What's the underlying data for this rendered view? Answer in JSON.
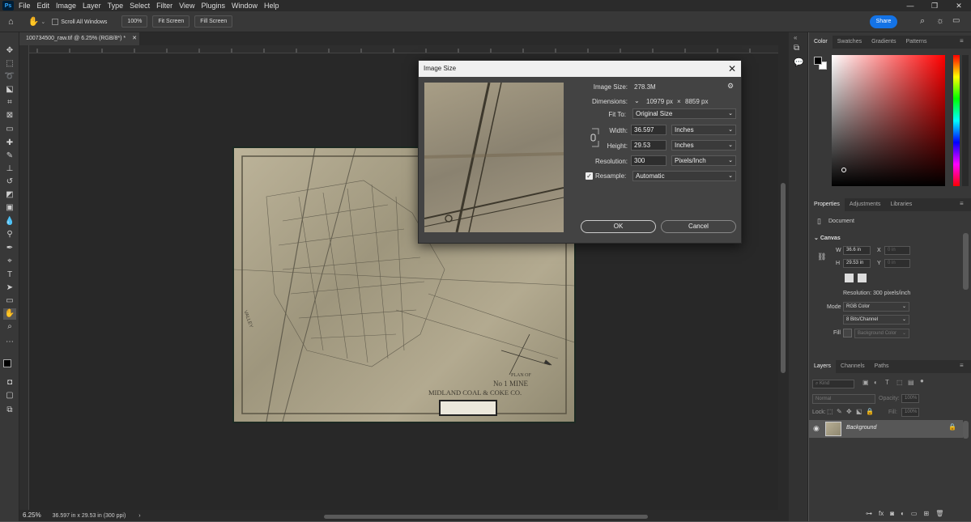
{
  "menubar": {
    "app_icon": "Ps",
    "items": [
      "File",
      "Edit",
      "Image",
      "Layer",
      "Type",
      "Select",
      "Filter",
      "View",
      "Plugins",
      "Window",
      "Help"
    ]
  },
  "options_bar": {
    "scroll_all_label": "Scroll All Windows",
    "zoom_100": "100%",
    "fit_screen": "Fit Screen",
    "fill_screen": "Fill Screen",
    "share": "Share"
  },
  "document": {
    "tab_title": "100734500_raw.tif @ 6.25% (RGB/8*) *"
  },
  "status_bar": {
    "zoom": "6.25%",
    "info": "36.597 in x 29.53 in (300 ppi)"
  },
  "map_text": {
    "title_line1": "PLAN OF",
    "title_line2": "No 1 MINE",
    "title_line3": "MIDLAND COAL & COKE CO.",
    "valley": "VALLEY"
  },
  "image_size_dialog": {
    "title": "Image Size",
    "image_size_label": "Image Size:",
    "image_size_value": "278.3M",
    "dimensions_label": "Dimensions:",
    "dim_w": "10979 px",
    "dim_x": "×",
    "dim_h": "8859 px",
    "fit_to_label": "Fit To:",
    "fit_to_value": "Original Size",
    "width_label": "Width:",
    "width_value": "36.597",
    "width_unit": "Inches",
    "height_label": "Height:",
    "height_value": "29.53",
    "height_unit": "Inches",
    "resolution_label": "Resolution:",
    "resolution_value": "300",
    "resolution_unit": "Pixels/Inch",
    "resample_label": "Resample:",
    "resample_value": "Automatic",
    "resample_checked": true,
    "ok": "OK",
    "cancel": "Cancel"
  },
  "color_panel": {
    "tabs": [
      "Color",
      "Swatches",
      "Gradients",
      "Patterns"
    ]
  },
  "properties_panel": {
    "tabs": [
      "Properties",
      "Adjustments",
      "Libraries"
    ],
    "type": "Document",
    "section": "Canvas",
    "w_label": "W",
    "w_value": "36.6 in",
    "x_label": "X",
    "x_value": "0 in",
    "h_label": "H",
    "h_value": "29.53 in",
    "y_label": "Y",
    "y_value": "0 in",
    "resolution": "Resolution: 300 pixels/inch",
    "mode_label": "Mode",
    "mode_value": "RGB Color",
    "bits_value": "8 Bits/Channel",
    "fill_label": "Fill",
    "fill_value": "Background Color"
  },
  "layers_panel": {
    "tabs": [
      "Layers",
      "Channels",
      "Paths"
    ],
    "kind_placeholder": "Kind",
    "blend_mode": "Normal",
    "opacity_label": "Opacity:",
    "opacity_value": "100%",
    "lock_label": "Lock:",
    "fill_label": "Fill:",
    "fill_value": "100%",
    "layer_name": "Background"
  }
}
